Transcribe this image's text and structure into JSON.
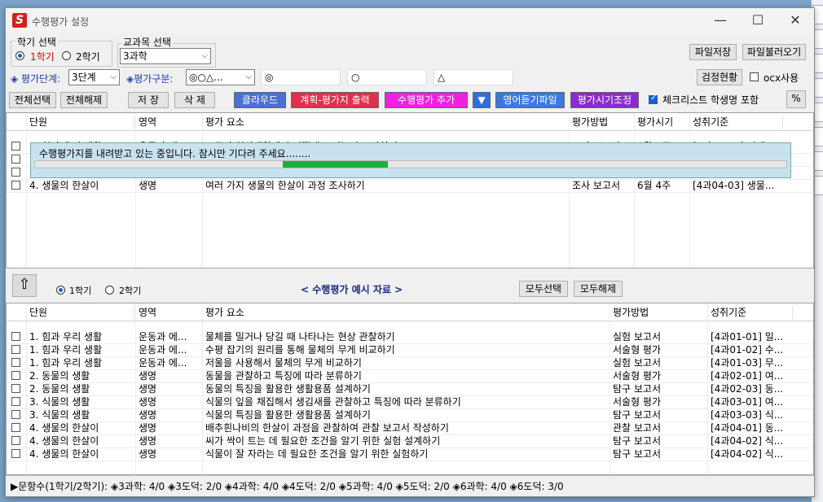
{
  "window": {
    "title": "수행평가 설정",
    "minimize": "—",
    "maximize": "☐",
    "close": "✕"
  },
  "semester_group": {
    "label": "학기 선택",
    "options": [
      "1학기",
      "2학기"
    ],
    "selected": "1학기"
  },
  "subject_group": {
    "label": "교과목 선택",
    "value": "3과학"
  },
  "top_buttons": {
    "save_file": "파일저장",
    "load_file": "파일불러오기",
    "check_status": "검정현황",
    "ocx_label": "ocx사용"
  },
  "eval_row": {
    "stage_label": "◈ 평가단계:",
    "stage_value": "3단계",
    "type_label": "◈평가구분:",
    "type_value": "◎○△...",
    "field1": "◎",
    "field2": "○",
    "field3": "△"
  },
  "toolbar": {
    "select_all": "전체선택",
    "deselect_all": "전체해제",
    "save": "저 장",
    "delete": "삭 제",
    "cloud": "클라우드",
    "plan_print": "계획-평가지 출력",
    "add_eval": "수행평가 추가",
    "dropdown": "▼",
    "video_file": "영어듣기파일",
    "schedule": "평가시기조정",
    "checklist_label": "체크리스트 학생명 포함",
    "percent": "%"
  },
  "top_grid": {
    "headers": [
      "단원",
      "영역",
      "평가 요소",
      "평가방법",
      "평가시기",
      "성취기준"
    ],
    "rows": [
      [
        "1. 힘과 우리 생활",
        "운동과 에...",
        "도구가 일상생활에서 어떻게 쓰이는지 조사하기",
        "조사 보고서",
        "4월 2주",
        "[4과01-04] 지레..."
      ],
      [
        "",
        "",
        "",
        "",
        "",
        ""
      ],
      [
        "",
        "",
        "",
        "",
        "",
        ""
      ],
      [
        "4. 생물의 한살이",
        "생명",
        "여러 가지 생물의 한살이 과정 조사하기",
        "조사 보고서",
        "6월 4주",
        "[4과04-03] 생물..."
      ]
    ]
  },
  "progress": {
    "message": "수행평가지를 내려받고 있는 중입니다. 잠시만 기다려 주세요........",
    "value": 0.14,
    "offset": 0.33
  },
  "middle": {
    "up_icon": "up-arrow-icon",
    "semester_options": [
      "1학기",
      "2학기"
    ],
    "semester_selected": "1학기",
    "title": "< 수행평가 예시 자료 >",
    "select_all": "모두선택",
    "deselect_all": "모두해제"
  },
  "bottom_grid": {
    "headers": [
      "단원",
      "영역",
      "평가 요소",
      "평가방법",
      "성취기준"
    ],
    "rows": [
      [
        "1. 힘과 우리 생활",
        "운동과 에...",
        "물체를 밀거나 당길 때 나타나는 현상 관찰하기",
        "실험 보고서",
        "[4과01-01] 일..."
      ],
      [
        "1. 힘과 우리 생활",
        "운동과 에...",
        "수평 잡기의 원리를 통해 물체의 무게 비교하기",
        "서술형 평가",
        "[4과01-02] 수..."
      ],
      [
        "1. 힘과 우리 생활",
        "운동과 에...",
        "저울을 사용해서 물체의 무게 비교하기",
        "실험 보고서",
        "[4과01-03] 무..."
      ],
      [
        "2. 동물의 생활",
        "생명",
        "동물을 관찰하고 특징에 따라 분류하기",
        "서술형 평가",
        "[4과02-01] 여..."
      ],
      [
        "2. 동물의 생활",
        "생명",
        "동물의 특징을 활용한 생활용품 설계하기",
        "탐구 보고서",
        "[4과02-03] 동..."
      ],
      [
        "3. 식물의 생활",
        "생명",
        "식물의 잎을 채집해서 생김새를 관찰하고 특징에 따라 분류하기",
        "서술형 평가",
        "[4과03-01] 여..."
      ],
      [
        "3. 식물의 생활",
        "생명",
        "식물의 특징을 활용한 생활용품 설계하기",
        "탐구 보고서",
        "[4과03-03] 식..."
      ],
      [
        "4. 생물의 한살이",
        "생명",
        "배추흰나비의 한살이 과정을 관찰하여 관찰 보고서 작성하기",
        "관찰 보고서",
        "[4과04-01] 동..."
      ],
      [
        "4. 생물의 한살이",
        "생명",
        "씨가 싹이 트는 데 필요한 조건을 알기 위한 실험 설계하기",
        "탐구 보고서",
        "[4과04-02] 식..."
      ],
      [
        "4. 생물의 한살이",
        "생명",
        "식물이 잘 자라는 데 필요한 조건을 알기 위한 실험하기",
        "탐구 보고서",
        "[4과04-02] 식..."
      ]
    ]
  },
  "statusbar": {
    "text": "▶문항수(1학기/2학기):  ◈3과학: 4/0  ◈3도덕: 2/0  ◈4과학: 4/0  ◈4도덕: 2/0  ◈5과학: 4/0  ◈5도덕: 2/0  ◈6과학: 4/0  ◈6도덕: 3/0"
  },
  "colors": {
    "cloud": "#4a6fd8",
    "plan_print": "#e0304c",
    "add_eval": "#f020e0",
    "dropdown": "#2e6fe0",
    "video_file": "#3a7ae0",
    "schedule": "#8a2ad0",
    "progress_fill": "#1fae3c",
    "progress_bg": "#c8e2ef"
  }
}
